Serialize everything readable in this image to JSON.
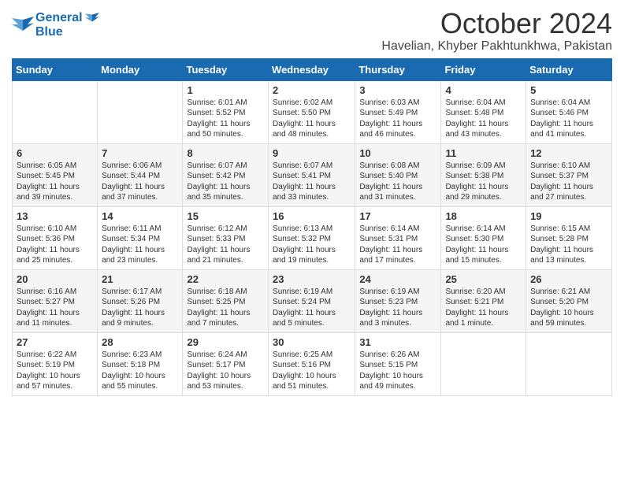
{
  "header": {
    "logo_line1": "General",
    "logo_line2": "Blue",
    "month": "October 2024",
    "location": "Havelian, Khyber Pakhtunkhwa, Pakistan"
  },
  "weekdays": [
    "Sunday",
    "Monday",
    "Tuesday",
    "Wednesday",
    "Thursday",
    "Friday",
    "Saturday"
  ],
  "weeks": [
    [
      {
        "day": "",
        "text": ""
      },
      {
        "day": "",
        "text": ""
      },
      {
        "day": "1",
        "text": "Sunrise: 6:01 AM\nSunset: 5:52 PM\nDaylight: 11 hours and 50 minutes."
      },
      {
        "day": "2",
        "text": "Sunrise: 6:02 AM\nSunset: 5:50 PM\nDaylight: 11 hours and 48 minutes."
      },
      {
        "day": "3",
        "text": "Sunrise: 6:03 AM\nSunset: 5:49 PM\nDaylight: 11 hours and 46 minutes."
      },
      {
        "day": "4",
        "text": "Sunrise: 6:04 AM\nSunset: 5:48 PM\nDaylight: 11 hours and 43 minutes."
      },
      {
        "day": "5",
        "text": "Sunrise: 6:04 AM\nSunset: 5:46 PM\nDaylight: 11 hours and 41 minutes."
      }
    ],
    [
      {
        "day": "6",
        "text": "Sunrise: 6:05 AM\nSunset: 5:45 PM\nDaylight: 11 hours and 39 minutes."
      },
      {
        "day": "7",
        "text": "Sunrise: 6:06 AM\nSunset: 5:44 PM\nDaylight: 11 hours and 37 minutes."
      },
      {
        "day": "8",
        "text": "Sunrise: 6:07 AM\nSunset: 5:42 PM\nDaylight: 11 hours and 35 minutes."
      },
      {
        "day": "9",
        "text": "Sunrise: 6:07 AM\nSunset: 5:41 PM\nDaylight: 11 hours and 33 minutes."
      },
      {
        "day": "10",
        "text": "Sunrise: 6:08 AM\nSunset: 5:40 PM\nDaylight: 11 hours and 31 minutes."
      },
      {
        "day": "11",
        "text": "Sunrise: 6:09 AM\nSunset: 5:38 PM\nDaylight: 11 hours and 29 minutes."
      },
      {
        "day": "12",
        "text": "Sunrise: 6:10 AM\nSunset: 5:37 PM\nDaylight: 11 hours and 27 minutes."
      }
    ],
    [
      {
        "day": "13",
        "text": "Sunrise: 6:10 AM\nSunset: 5:36 PM\nDaylight: 11 hours and 25 minutes."
      },
      {
        "day": "14",
        "text": "Sunrise: 6:11 AM\nSunset: 5:34 PM\nDaylight: 11 hours and 23 minutes."
      },
      {
        "day": "15",
        "text": "Sunrise: 6:12 AM\nSunset: 5:33 PM\nDaylight: 11 hours and 21 minutes."
      },
      {
        "day": "16",
        "text": "Sunrise: 6:13 AM\nSunset: 5:32 PM\nDaylight: 11 hours and 19 minutes."
      },
      {
        "day": "17",
        "text": "Sunrise: 6:14 AM\nSunset: 5:31 PM\nDaylight: 11 hours and 17 minutes."
      },
      {
        "day": "18",
        "text": "Sunrise: 6:14 AM\nSunset: 5:30 PM\nDaylight: 11 hours and 15 minutes."
      },
      {
        "day": "19",
        "text": "Sunrise: 6:15 AM\nSunset: 5:28 PM\nDaylight: 11 hours and 13 minutes."
      }
    ],
    [
      {
        "day": "20",
        "text": "Sunrise: 6:16 AM\nSunset: 5:27 PM\nDaylight: 11 hours and 11 minutes."
      },
      {
        "day": "21",
        "text": "Sunrise: 6:17 AM\nSunset: 5:26 PM\nDaylight: 11 hours and 9 minutes."
      },
      {
        "day": "22",
        "text": "Sunrise: 6:18 AM\nSunset: 5:25 PM\nDaylight: 11 hours and 7 minutes."
      },
      {
        "day": "23",
        "text": "Sunrise: 6:19 AM\nSunset: 5:24 PM\nDaylight: 11 hours and 5 minutes."
      },
      {
        "day": "24",
        "text": "Sunrise: 6:19 AM\nSunset: 5:23 PM\nDaylight: 11 hours and 3 minutes."
      },
      {
        "day": "25",
        "text": "Sunrise: 6:20 AM\nSunset: 5:21 PM\nDaylight: 11 hours and 1 minute."
      },
      {
        "day": "26",
        "text": "Sunrise: 6:21 AM\nSunset: 5:20 PM\nDaylight: 10 hours and 59 minutes."
      }
    ],
    [
      {
        "day": "27",
        "text": "Sunrise: 6:22 AM\nSunset: 5:19 PM\nDaylight: 10 hours and 57 minutes."
      },
      {
        "day": "28",
        "text": "Sunrise: 6:23 AM\nSunset: 5:18 PM\nDaylight: 10 hours and 55 minutes."
      },
      {
        "day": "29",
        "text": "Sunrise: 6:24 AM\nSunset: 5:17 PM\nDaylight: 10 hours and 53 minutes."
      },
      {
        "day": "30",
        "text": "Sunrise: 6:25 AM\nSunset: 5:16 PM\nDaylight: 10 hours and 51 minutes."
      },
      {
        "day": "31",
        "text": "Sunrise: 6:26 AM\nSunset: 5:15 PM\nDaylight: 10 hours and 49 minutes."
      },
      {
        "day": "",
        "text": ""
      },
      {
        "day": "",
        "text": ""
      }
    ]
  ]
}
